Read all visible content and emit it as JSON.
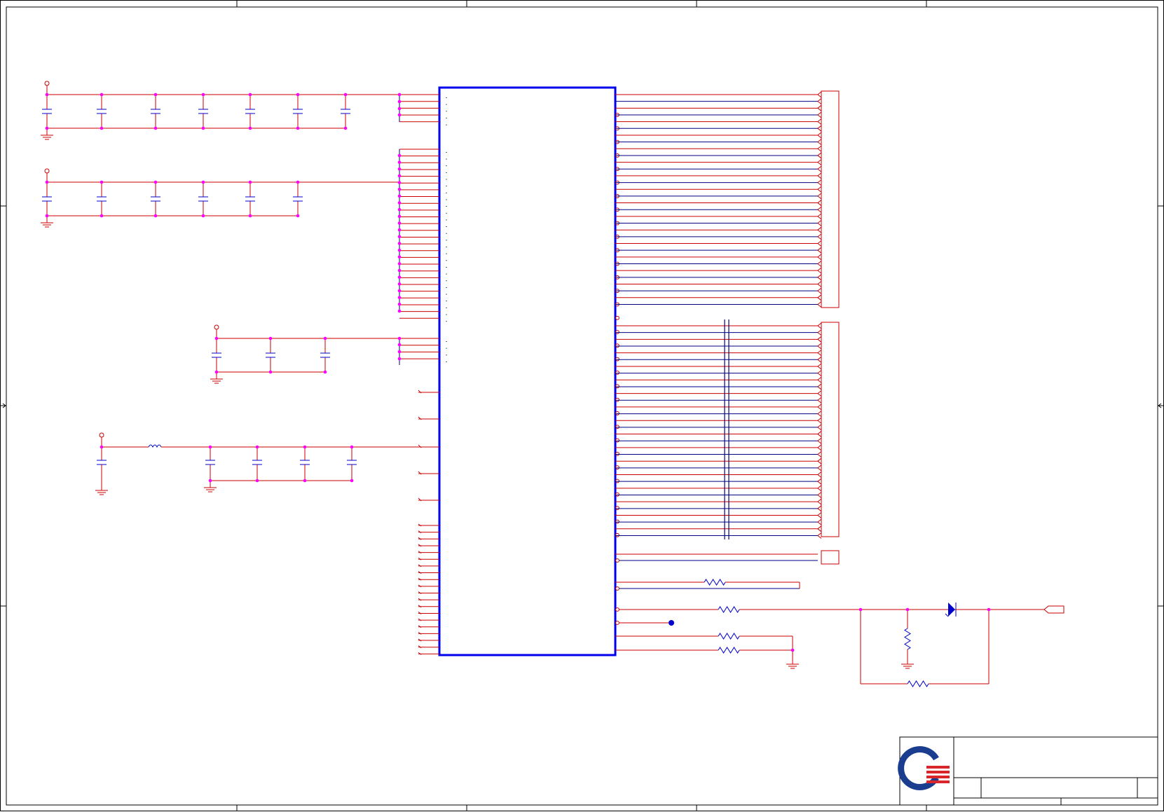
{
  "sheet": {
    "frame_color": "#000000",
    "wire_color": "#cc0000",
    "net_color": "#000080",
    "part_color": "#0000cc",
    "junction_color": "#ff00ff"
  },
  "logo": {
    "primary_color": "#1a3d8f",
    "accent_color": "#d9262b"
  },
  "title_block": {
    "title": "",
    "size": "",
    "document_number": "",
    "rev": "",
    "date": "",
    "sheet": ""
  }
}
